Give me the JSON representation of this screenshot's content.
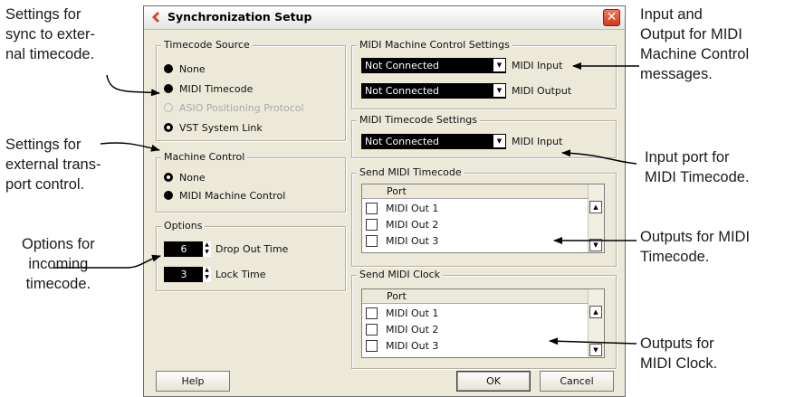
{
  "dialog": {
    "title": "Synchronization Setup",
    "close_glyph": "✕",
    "accent_color": "#e0401b"
  },
  "timecode_source": {
    "legend": "Timecode Source",
    "options": [
      {
        "label": "None",
        "state": "unselected",
        "enabled": true
      },
      {
        "label": "MIDI Timecode",
        "state": "unselected",
        "enabled": true
      },
      {
        "label": "ASIO Positioning Protocol",
        "state": "unselected",
        "enabled": false
      },
      {
        "label": "VST System Link",
        "state": "selected",
        "enabled": true
      }
    ]
  },
  "machine_control": {
    "legend": "Machine Control",
    "options": [
      {
        "label": "None",
        "state": "selected"
      },
      {
        "label": "MIDI Machine Control",
        "state": "unselected"
      }
    ]
  },
  "options": {
    "legend": "Options",
    "drop_out_time": {
      "value": "6",
      "label": "Drop Out Time"
    },
    "lock_time": {
      "value": "3",
      "label": "Lock Time"
    }
  },
  "mmc_settings": {
    "legend": "MIDI Machine Control Settings",
    "input": {
      "value": "Not Connected",
      "label": "MIDI Input"
    },
    "output": {
      "value": "Not Connected",
      "label": "MIDI Output"
    }
  },
  "mtc_settings": {
    "legend": "MIDI Timecode Settings",
    "input": {
      "value": "Not Connected",
      "label": "MIDI Input"
    }
  },
  "send_mtc": {
    "legend": "Send MIDI Timecode",
    "column_header": "Port",
    "ports": [
      "MIDI Out 1",
      "MIDI Out 2",
      "MIDI Out 3"
    ]
  },
  "send_clock": {
    "legend": "Send MIDI Clock",
    "column_header": "Port",
    "ports": [
      "MIDI Out 1",
      "MIDI Out 2",
      "MIDI Out 3"
    ]
  },
  "buttons": {
    "help": "Help",
    "ok": "OK",
    "cancel": "Cancel"
  },
  "annotations": {
    "sync_settings": [
      "Settings for",
      "sync to exter-",
      "nal timecode."
    ],
    "transport_settings": [
      "Settings for",
      "external trans-",
      "port control."
    ],
    "options_note": [
      "Options for",
      "incoming",
      "timecode."
    ],
    "mmc_io": [
      "Input and",
      "Output for MIDI",
      "Machine Control",
      "messages."
    ],
    "mtc_input": [
      "Input port for",
      "MIDI Timecode."
    ],
    "mtc_outputs": [
      "Outputs for MIDI",
      "Timecode."
    ],
    "clock_outputs": [
      "Outputs for",
      "MIDI Clock."
    ]
  }
}
